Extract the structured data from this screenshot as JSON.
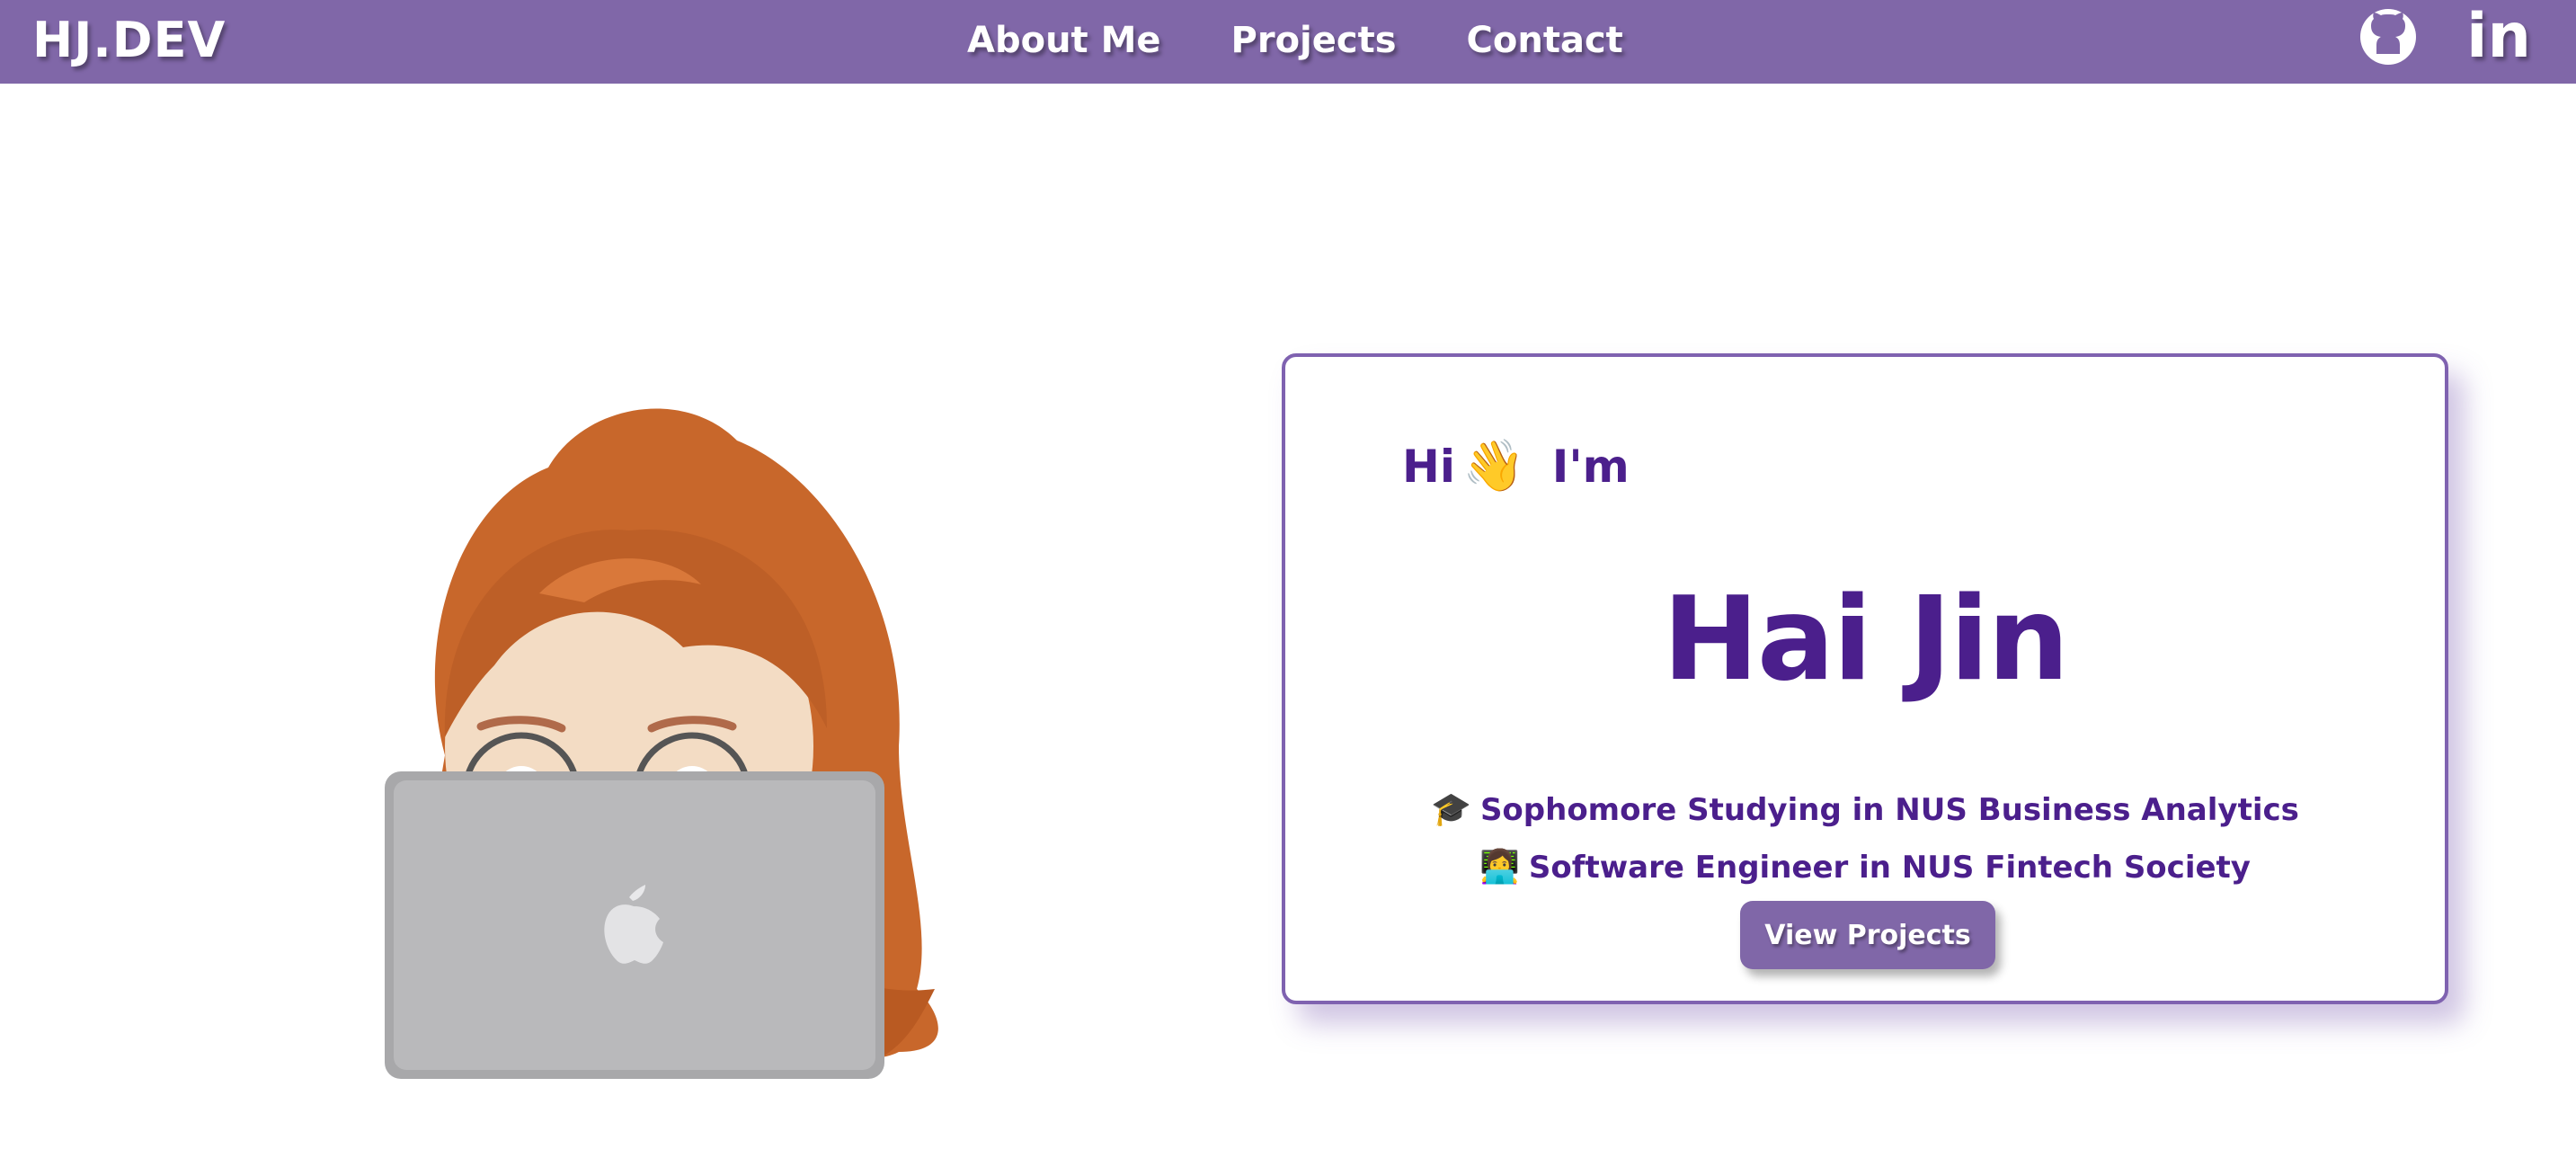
{
  "header": {
    "logo": "HJ.DEV",
    "nav": [
      "About Me",
      "Projects",
      "Contact"
    ],
    "social": [
      "github-icon",
      "linkedin-icon"
    ],
    "linkedin_glyph": "in"
  },
  "hero": {
    "greeting_hi": "Hi",
    "greeting_emoji": "👋",
    "greeting_im": "I'm",
    "name": "Hai Jin",
    "bio": [
      {
        "emoji": "🎓",
        "text": "Sophomore Studying in NUS Business Analytics"
      },
      {
        "emoji": "👩‍💻",
        "text": "Software Engineer in NUS Fintech Society"
      }
    ],
    "cta_label": "View Projects"
  },
  "colors": {
    "nav_bg": "#8067a8",
    "accent_text": "#4b1f8c",
    "card_border": "#7f62b0"
  }
}
